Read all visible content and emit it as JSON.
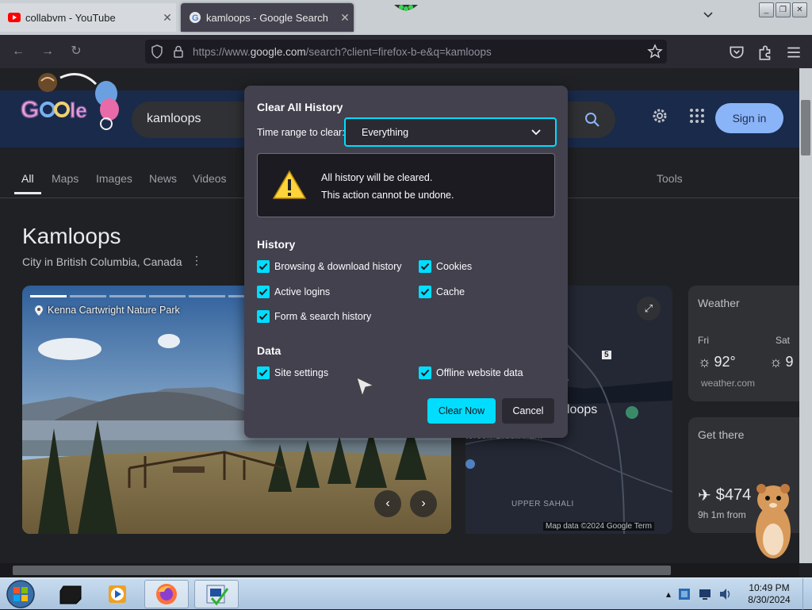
{
  "browser": {
    "tabs": [
      {
        "title": "collabvm - YouTube",
        "favicon": "youtube-icon",
        "active": false
      },
      {
        "title": "kamloops - Google Search",
        "favicon": "google-icon",
        "active": true
      }
    ],
    "url": {
      "prefix": "https://www.",
      "domain": "google.com",
      "path": "/search?client=firefox-b-e&q=kamloops"
    }
  },
  "google": {
    "query": "kamloops",
    "sign_in": "Sign in",
    "tabs": [
      "All",
      "Maps",
      "Images",
      "News",
      "Videos"
    ],
    "tools": "Tools",
    "knowledge_panel": {
      "title": "Kamloops",
      "subtitle": "City in British Columbia, Canada",
      "photo_caption": "Kenna Cartwright Nature Park",
      "map_labels": {
        "city": "loops",
        "creek": "terson Creek Park",
        "district": "UPPER SAHALI",
        "route": "5"
      },
      "map_credit": "Map data ©2024 Google  Term",
      "weather": {
        "title": "Weather",
        "day1": "Fri",
        "day2": "Sat",
        "temp1": "92°",
        "temp2": "9",
        "source": "weather.com"
      },
      "directions": {
        "title": "Get there",
        "price": "$474",
        "duration": "9h 1m from"
      }
    }
  },
  "dialog": {
    "title": "Clear All History",
    "time_range_label": "Time range to clear:",
    "time_range_value": "Everything",
    "warning_line1": "All history will be cleared.",
    "warning_line2": "This action cannot be undone.",
    "history_heading": "History",
    "history_items": [
      {
        "label": "Browsing & download history",
        "checked": true
      },
      {
        "label": "Cookies",
        "checked": true
      },
      {
        "label": "Active logins",
        "checked": true
      },
      {
        "label": "Cache",
        "checked": true
      },
      {
        "label": "Form & search history",
        "checked": true
      }
    ],
    "data_heading": "Data",
    "data_items": [
      {
        "label": "Site settings",
        "checked": true
      },
      {
        "label": "Offline website data",
        "checked": true
      }
    ],
    "clear_button": "Clear Now",
    "cancel_button": "Cancel",
    "accent_color": "#00ddff"
  },
  "taskbar": {
    "time": "10:49 PM",
    "date": "8/30/2024"
  }
}
